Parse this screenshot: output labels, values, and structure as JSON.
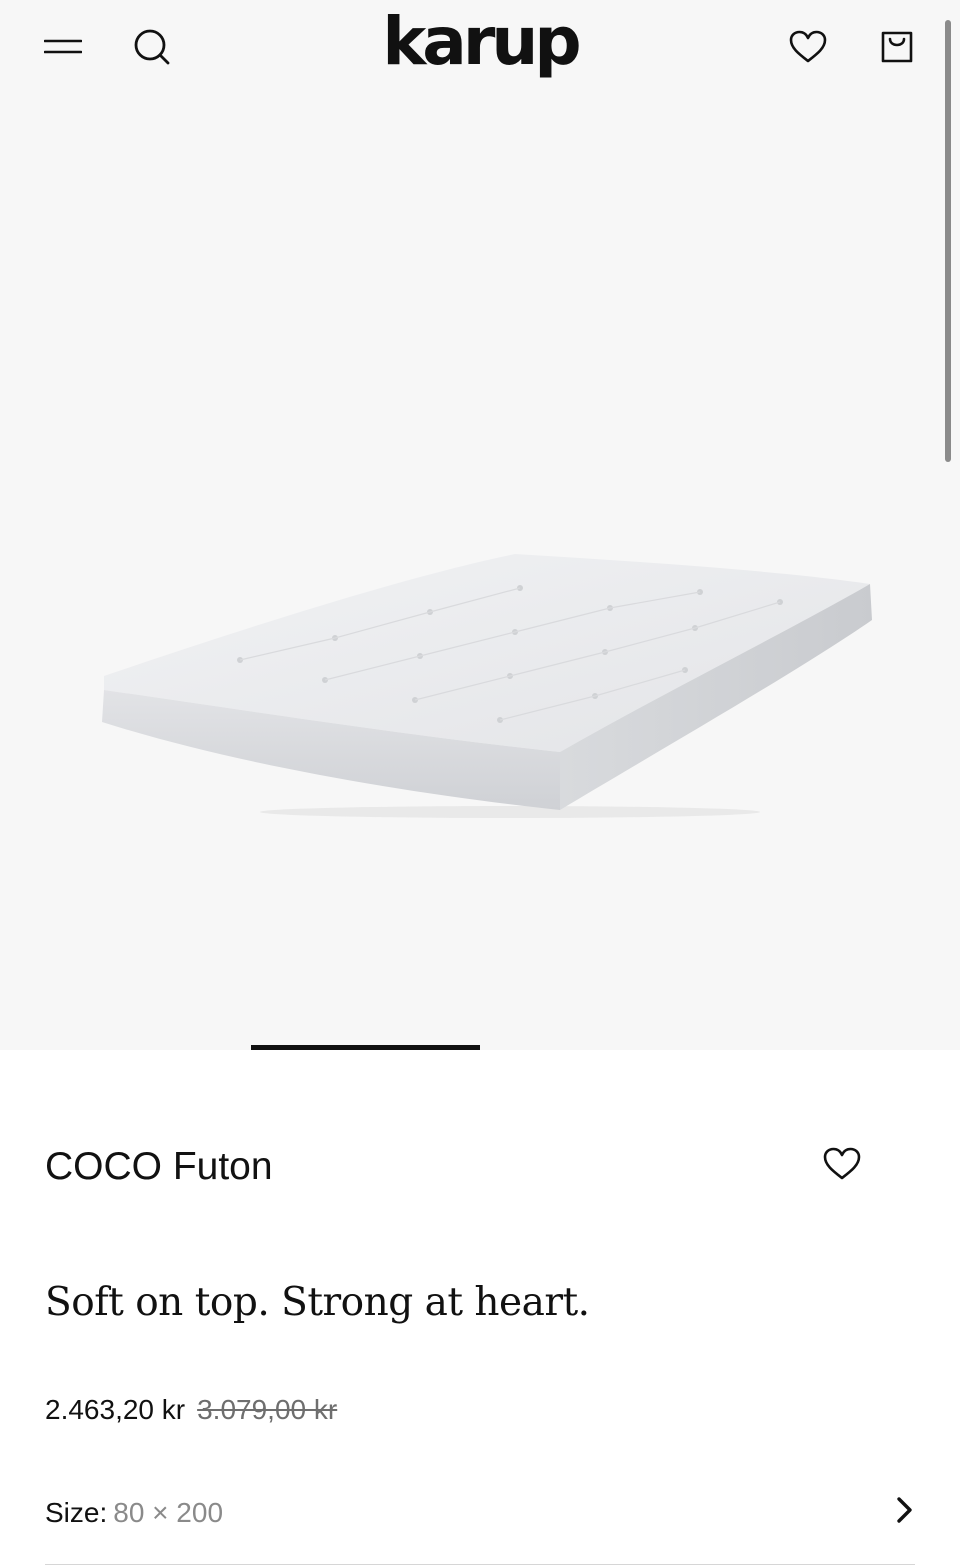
{
  "header": {
    "logo_text": "karup",
    "menu_icon": "hamburger-menu-icon",
    "search_icon": "search-icon",
    "wishlist_icon": "heart-icon",
    "cart_icon": "shopping-bag-icon"
  },
  "gallery": {
    "image_subject": "white tufted futon mattress",
    "slide_indicator_progress": 0.25
  },
  "product": {
    "title": "COCO Futon",
    "tagline": "Soft on top. Strong at heart.",
    "price_current": "2.463,20 kr",
    "price_original": "3.079,00 kr",
    "favorite_icon": "heart-outline-icon",
    "size": {
      "label": "Size:",
      "value": "80 × 200",
      "icon": "chevron-right-icon"
    }
  },
  "colors": {
    "text": "#111111",
    "hero_background": "#f7f7f7",
    "muted_text": "#8a8a8a",
    "strikethrough_price": "#6e6e6e"
  }
}
